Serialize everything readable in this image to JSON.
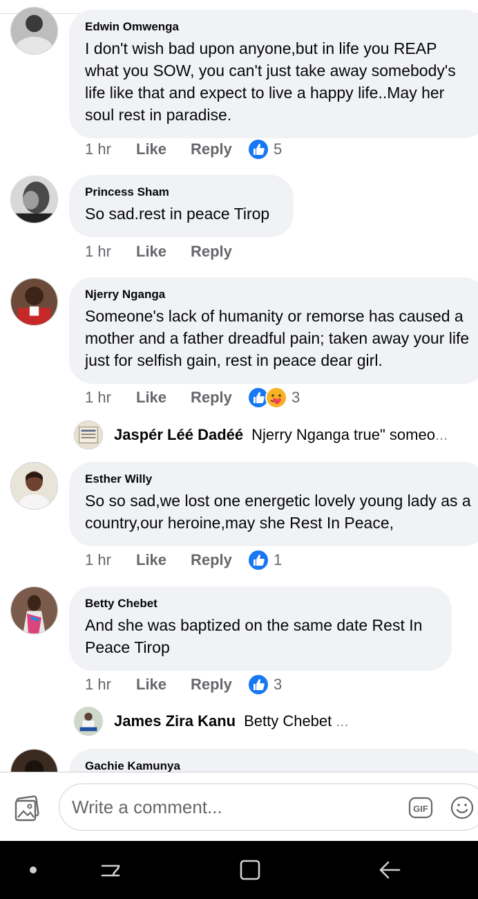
{
  "comments": [
    {
      "author": "Edwin Omwenga",
      "text": "I don't wish bad upon anyone,but in life you REAP what you SOW, you can't just take away somebody's life like that and expect to live a happy life..May her soul rest in paradise.",
      "time": "1 hr",
      "like_label": "Like",
      "reply_label": "Reply",
      "reactions": [
        "like"
      ],
      "reaction_count": "5"
    },
    {
      "author": "Princess Sham",
      "text": "So sad.rest in peace Tirop",
      "time": "1 hr",
      "like_label": "Like",
      "reply_label": "Reply",
      "reactions": [],
      "reaction_count": ""
    },
    {
      "author": "Njerry Nganga",
      "text": "Someone's lack of humanity or remorse has caused a mother and a father dreadful pain; taken away your life just for selfish gain, rest in peace dear girl.",
      "time": "1 hr",
      "like_label": "Like",
      "reply_label": "Reply",
      "reactions": [
        "like",
        "care"
      ],
      "reaction_count": "3",
      "reply_preview": {
        "author": "Jaspér Léé Dadéé",
        "text": "Njerry Nganga true\" someo",
        "ellipsis": "..."
      }
    },
    {
      "author": "Esther Willy",
      "text": "So so sad,we lost one energetic lovely young lady as a country,our heroine,may she Rest In Peace,",
      "time": "1 hr",
      "like_label": "Like",
      "reply_label": "Reply",
      "reactions": [
        "like"
      ],
      "reaction_count": "1"
    },
    {
      "author": "Betty Chebet",
      "text": "And she was baptized on the same date Rest In Peace Tirop",
      "time": "1 hr",
      "like_label": "Like",
      "reply_label": "Reply",
      "reactions": [
        "like"
      ],
      "reaction_count": "3",
      "reply_preview": {
        "author": "James Zira Kanu",
        "text": "Betty Chebet",
        "ellipsis": "..."
      }
    },
    {
      "author": "Gachie Kamunya",
      "text": "",
      "time": "",
      "like_label": "",
      "reply_label": "",
      "reactions": [],
      "reaction_count": ""
    }
  ],
  "composer": {
    "placeholder": "Write a comment...",
    "photo_icon": "photo-icon",
    "gif_icon": "gif-icon",
    "emoji_icon": "emoji-icon"
  },
  "navbar": {
    "icons": [
      "dot-icon",
      "recent-apps-icon",
      "home-icon",
      "back-icon"
    ]
  },
  "colors": {
    "like_blue": "#1877f2",
    "bubble_bg": "#f0f2f5",
    "meta_gray": "#65676b",
    "care_yellow": "#f7b125"
  }
}
